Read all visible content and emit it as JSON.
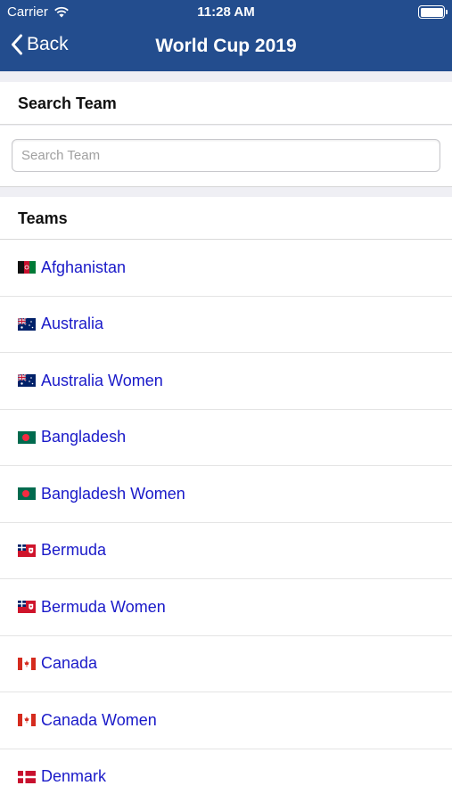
{
  "status_bar": {
    "carrier": "Carrier",
    "time": "11:28 AM"
  },
  "nav": {
    "back_label": "Back",
    "title": "World Cup 2019"
  },
  "search": {
    "section_title": "Search Team",
    "placeholder": "Search Team",
    "value": ""
  },
  "teams_section": {
    "title": "Teams",
    "items": [
      {
        "name": "Afghanistan",
        "flag": "afghanistan-flag-icon"
      },
      {
        "name": "Australia",
        "flag": "australia-flag-icon"
      },
      {
        "name": "Australia Women",
        "flag": "australia-flag-icon"
      },
      {
        "name": "Bangladesh",
        "flag": "bangladesh-flag-icon"
      },
      {
        "name": "Bangladesh Women",
        "flag": "bangladesh-flag-icon"
      },
      {
        "name": "Bermuda",
        "flag": "bermuda-flag-icon"
      },
      {
        "name": "Bermuda Women",
        "flag": "bermuda-flag-icon"
      },
      {
        "name": "Canada",
        "flag": "canada-flag-icon"
      },
      {
        "name": "Canada Women",
        "flag": "canada-flag-icon"
      },
      {
        "name": "Denmark",
        "flag": "denmark-flag-icon"
      }
    ]
  },
  "colors": {
    "nav_bar": "#234d8e",
    "link": "#1a1ac9",
    "background": "#efeff4"
  }
}
